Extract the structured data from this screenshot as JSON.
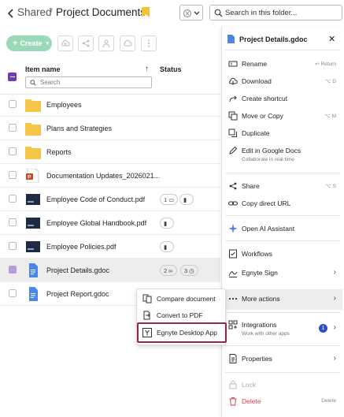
{
  "header": {
    "breadcrumb_root": "Shared",
    "breadcrumb_sep": "/",
    "title": "Project Documents",
    "search_placeholder": "Search in this folder..."
  },
  "toolbar": {
    "create_label": "Create"
  },
  "list": {
    "col_name": "Item name",
    "col_status": "Status",
    "filter_placeholder": "Search",
    "rows": [
      {
        "name": "Employees",
        "type": "folder"
      },
      {
        "name": "Plans and Strategies",
        "type": "folder"
      },
      {
        "name": "Reports",
        "type": "folder"
      },
      {
        "name": "Documentation Updates_2026021...",
        "type": "pptx"
      },
      {
        "name": "Employee Code of Conduct.pdf",
        "type": "pdf",
        "comments": "1"
      },
      {
        "name": "Employee Global Handbook.pdf",
        "type": "pdf"
      },
      {
        "name": "Employee Policies.pdf",
        "type": "pdf"
      },
      {
        "name": "Project Details.gdoc",
        "type": "gdoc",
        "selected": true,
        "links": "2",
        "versions": "3"
      },
      {
        "name": "Project Report.gdoc",
        "type": "gdoc"
      }
    ]
  },
  "panel": {
    "file_name": "Project Details.gdoc",
    "items": {
      "rename": "Rename",
      "rename_sc": "↩ Return",
      "download": "Download",
      "download_sc": "⌥ D",
      "shortcut": "Create shortcut",
      "move": "Move or Copy",
      "move_sc": "⌥ M",
      "duplicate": "Duplicate",
      "edit": "Edit in Google Docs",
      "edit_sub": "Collaborate in real time",
      "share": "Share",
      "share_sc": "⌥ S",
      "copy_url": "Copy direct URL",
      "ai": "Open AI Assistant",
      "workflows": "Workflows",
      "sign": "Egnyte Sign",
      "more": "More actions",
      "integrations": "Integrations",
      "integrations_sub": "Work with other apps",
      "integrations_badge": "1",
      "properties": "Properties",
      "lock": "Lock",
      "delete": "Delete",
      "delete_sc": "Delete"
    }
  },
  "context_menu": {
    "compare": "Compare document",
    "convert": "Convert to PDF",
    "desktop": "Egnyte Desktop App"
  },
  "colors": {
    "accent": "#6b3fb3",
    "create_bg": "#9ad9b8",
    "highlight": "#8e2a47",
    "delete": "#d9414f",
    "folder": "#f4c74a",
    "gdoc": "#4a86e8"
  }
}
